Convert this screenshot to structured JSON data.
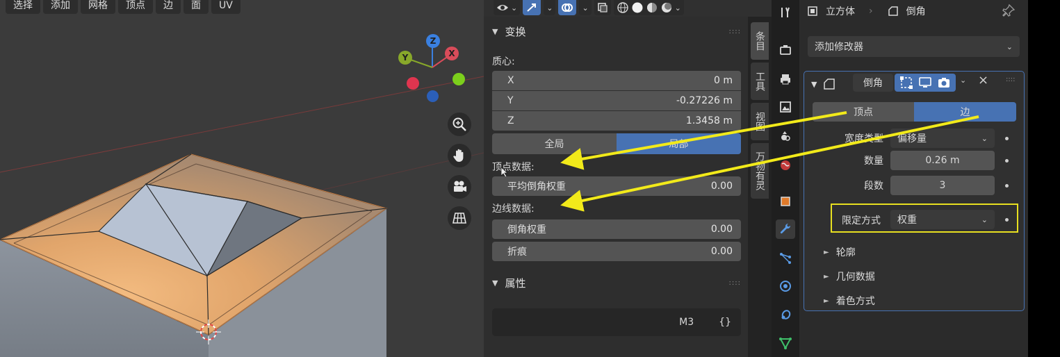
{
  "viewport": {
    "menu": [
      "选择",
      "添加",
      "网格",
      "顶点",
      "边",
      "面",
      "UV"
    ],
    "gizmo_axes": {
      "x": "X",
      "y": "Y",
      "z": "Z"
    }
  },
  "npanel": {
    "transform": {
      "title": "变换",
      "median_label": "质心:",
      "x_label": "X",
      "x_value": "0 m",
      "y_label": "Y",
      "y_value": "-0.27226 m",
      "z_label": "Z",
      "z_value": "1.3458 m",
      "global_label": "全局",
      "local_label": "局部"
    },
    "vertex_data_label": "顶点数据:",
    "mean_bevel_weight_label": "平均倒角权重",
    "mean_bevel_weight_value": "0.00",
    "edge_data_label": "边线数据:",
    "bevel_weight_label": "倒角权重",
    "bevel_weight_value": "0.00",
    "crease_label": "折痕",
    "crease_value": "0.00",
    "properties": {
      "title": "属性",
      "field_value": "M3",
      "field_suffix": "{}"
    },
    "tabs": [
      "条目",
      "工具",
      "视图",
      "万物有灵"
    ]
  },
  "properties_editor": {
    "breadcrumb": {
      "object": "立方体",
      "modifier": "倒角"
    },
    "add_modifier": "添加修改器",
    "modifier": {
      "name": "倒角",
      "affect_vertices": "顶点",
      "affect_edges": "边",
      "width_type_label": "宽度类型",
      "width_type_value": "偏移量",
      "amount_label": "数量",
      "amount_value": "0.26 m",
      "segments_label": "段数",
      "segments_value": "3",
      "limit_method_label": "限定方式",
      "limit_method_value": "权重",
      "subpanels": [
        "轮廓",
        "几何数据",
        "着色方式"
      ]
    }
  },
  "colors": {
    "accent": "#4772b3",
    "annotation_arrow": "#f2ea1a",
    "highlight_box": "#e8e020",
    "face_orange": "#e0a46a",
    "face_blue": "#b8c3d4"
  }
}
